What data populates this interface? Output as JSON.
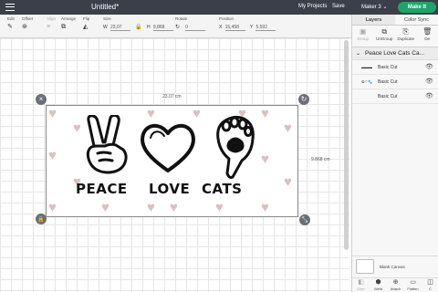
{
  "header": {
    "title": "Untitled*",
    "nav": [
      "My Projects",
      "Save"
    ],
    "machine": "Maker 3",
    "make_it": "Make It"
  },
  "toolbar": {
    "edit": "Edit",
    "offset": "Offset",
    "align": "Align",
    "arrange": "Arrange",
    "flip": "Flip",
    "size": "Size",
    "w_label": "W",
    "w_value": "23,07",
    "h_label": "H",
    "h_value": "9,868",
    "rotate": "Rotate",
    "rotate_value": "0",
    "position": "Position",
    "x_label": "X",
    "x_value": "15,458",
    "y_label": "Y",
    "y_value": "5,592"
  },
  "canvas": {
    "width_label": "23.07 cm",
    "height_label": "9.868 cm",
    "art": {
      "words": [
        "PEACE",
        "LOVE",
        "CATS"
      ]
    }
  },
  "panel": {
    "tabs": [
      "Layers",
      "Color Sync"
    ],
    "tools": [
      {
        "label": "Group",
        "icon": "▣",
        "enabled": false
      },
      {
        "label": "UnGroup",
        "icon": "⧉",
        "enabled": true
      },
      {
        "label": "Duplicate",
        "icon": "⎘",
        "enabled": true
      },
      {
        "label": "De",
        "icon": "🗑",
        "enabled": true
      }
    ],
    "group_name": "Peace Love Cats Ca...",
    "layers": [
      {
        "thumb": "▬▬▬",
        "label": "Basic Cut"
      },
      {
        "thumb": "☮♡🐾",
        "label": "Basic Cut"
      },
      {
        "thumb": "",
        "label": "Basic Cut"
      }
    ],
    "blank_canvas": "Blank Canvas",
    "bottom_tools": [
      {
        "label": "Slice",
        "icon": "◧",
        "enabled": false
      },
      {
        "label": "Weld",
        "icon": "⬢",
        "enabled": true
      },
      {
        "label": "Attach",
        "icon": "⊕",
        "enabled": true
      },
      {
        "label": "Flatten",
        "icon": "▭",
        "enabled": true
      },
      {
        "label": "C",
        "icon": "◫",
        "enabled": true
      }
    ]
  },
  "colors": {
    "accent": "#1fa36a",
    "topbar": "#3b3f4a",
    "hearts": "#d8c1bf"
  }
}
